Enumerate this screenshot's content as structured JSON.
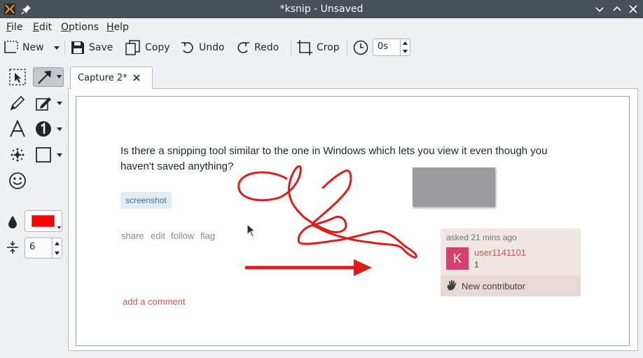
{
  "window": {
    "title": "*ksnip - Unsaved"
  },
  "menubar": {
    "file": {
      "mnemonic": "F",
      "rest": "ile"
    },
    "edit": {
      "mnemonic": "E",
      "rest": "dit"
    },
    "options": {
      "mnemonic": "O",
      "rest": "ptions"
    },
    "help": {
      "mnemonic": "H",
      "rest": "elp"
    }
  },
  "toolbar": {
    "new_label": "New",
    "save_label": "Save",
    "copy_label": "Copy",
    "undo_label": "Undo",
    "redo_label": "Redo",
    "crop_label": "Crop",
    "delay_value": "0s"
  },
  "tools": {
    "color": "#ff0000",
    "size_value": "6",
    "icons": [
      "select-icon",
      "arrow-icon",
      "pen-icon",
      "marker-icon",
      "text-icon",
      "number-icon",
      "blur-icon",
      "rectangle-icon",
      "sticker-icon",
      "opacity-icon"
    ]
  },
  "tab": {
    "label": "Capture 2*"
  },
  "capture": {
    "question": "Is there a snipping tool similar to the one in Windows which lets you view it even though you haven't saved anything?",
    "tag": "screenshot",
    "post_menu": [
      "share",
      "edit",
      "follow",
      "flag"
    ],
    "asked": "asked 21 mins ago",
    "avatar_letter": "K",
    "username": "user1141101",
    "reputation": "1",
    "contributor_label": "New contributor",
    "add_comment": "add a comment"
  },
  "colors": {
    "annotation": "#e11b1b",
    "titlebar": "#475057",
    "avatar": "#d6406e"
  }
}
